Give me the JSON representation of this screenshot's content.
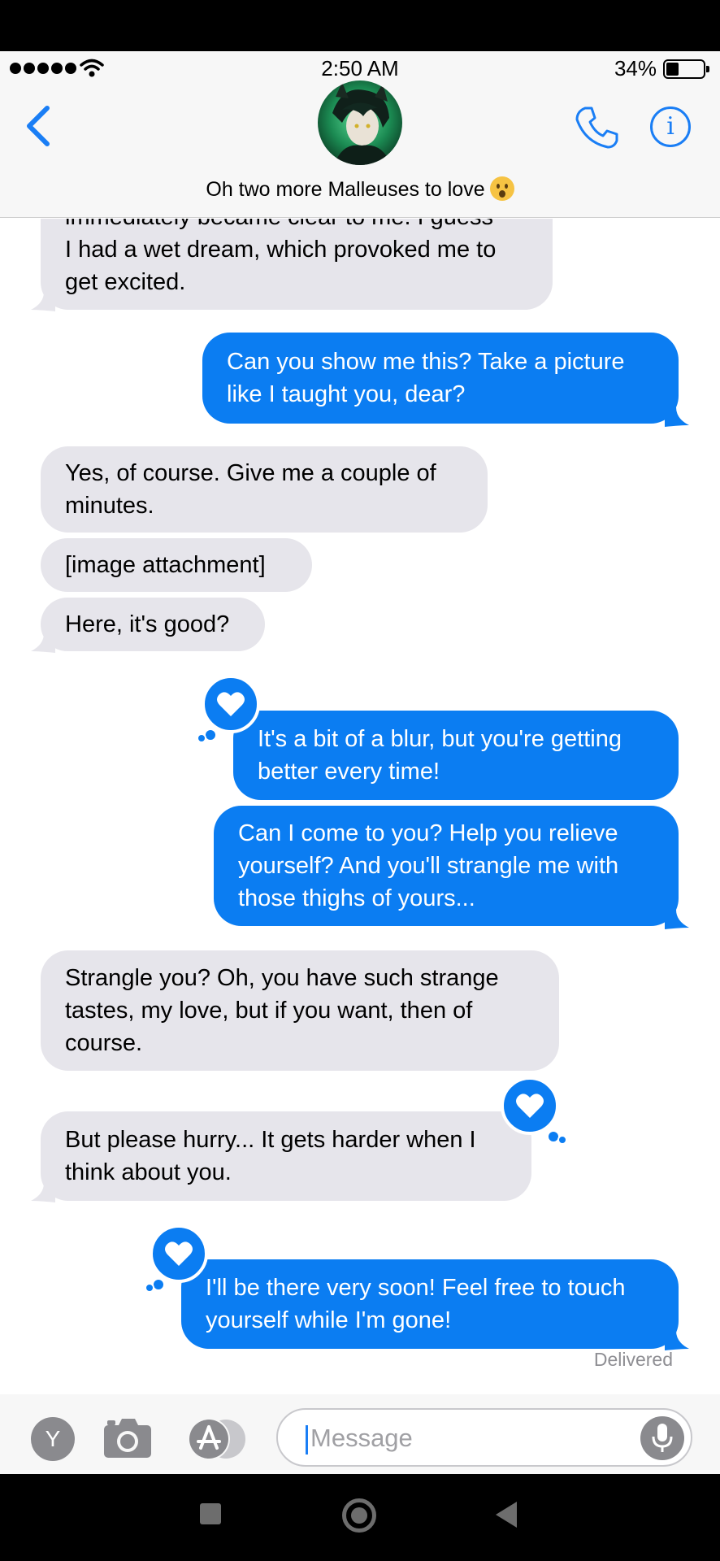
{
  "status_bar": {
    "time": "2:50 AM",
    "battery": "34%",
    "signal_icon": "signal-dots-icon",
    "wifi_icon": "wifi-icon",
    "battery_icon": "battery-icon"
  },
  "header": {
    "contact_name": "Oh two more Malleuses to love",
    "emoji": "astonished-face-emoji",
    "back_icon": "chevron-left-icon",
    "call_icon": "phone-icon",
    "info_icon": "info-icon",
    "info_glyph": "i"
  },
  "colors": {
    "sent_bubble": "#0b7df2",
    "received_bubble": "#e6e5eb",
    "accent": "#1a7ef5"
  },
  "messages": [
    {
      "from": "contact",
      "lines": [
        "immediately became clear to me. I guess",
        "I had a wet dream, which provoked me to",
        "get excited."
      ]
    },
    {
      "from": "me",
      "lines": [
        "Can you show me this? Take a picture",
        "like I taught you, dear?"
      ]
    },
    {
      "from": "contact",
      "lines": [
        "Yes, of course. Give me a couple of",
        "minutes."
      ]
    },
    {
      "from": "contact",
      "lines": [
        "[image attachment]"
      ]
    },
    {
      "from": "contact",
      "lines": [
        "Here, it's good?"
      ]
    },
    {
      "from": "me",
      "lines": [
        "It's a bit of a blur, but you're getting",
        "better every time!"
      ],
      "reaction": "heart"
    },
    {
      "from": "me",
      "lines": [
        "Can I come to you? Help you relieve",
        "yourself? And you'll strangle me with",
        "those thighs of yours..."
      ]
    },
    {
      "from": "contact",
      "lines": [
        "Strangle you? Oh, you have such strange",
        "tastes, my love, but if you want, then of",
        "course."
      ]
    },
    {
      "from": "contact",
      "lines": [
        "But please hurry... It gets harder when I",
        "think about you."
      ],
      "reaction": "heart"
    },
    {
      "from": "me",
      "lines": [
        "I'll be there very soon! Feel free to touch",
        "yourself while I'm gone!"
      ],
      "reaction": "heart"
    }
  ],
  "delivered_label": "Delivered",
  "input_bar": {
    "apps_y_label": "Y",
    "camera_icon": "camera-icon",
    "appstore_icon": "app-store-icon",
    "placeholder": "Message",
    "mic_icon": "microphone-icon"
  },
  "nav_bar": {
    "recents_icon": "square-icon",
    "home_icon": "circle-icon",
    "back_icon": "triangle-back-icon"
  }
}
